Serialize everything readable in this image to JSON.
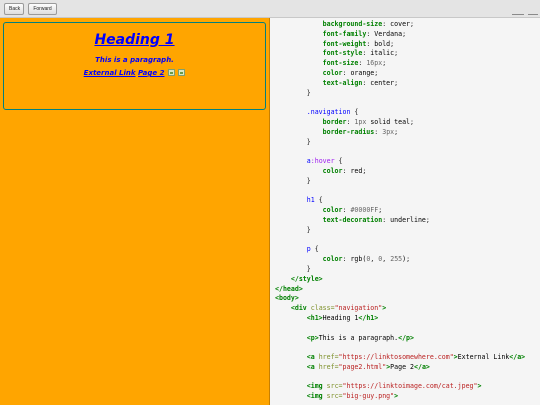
{
  "toolbar": {
    "back_label": "Back",
    "forward_label": "Forward"
  },
  "preview": {
    "heading": "Heading 1",
    "paragraph": "This is a paragraph.",
    "link1_label": "External Link",
    "link2_label": "Page 2",
    "colors": {
      "background": "#FFA500",
      "text": "#0000FF",
      "border": "#008080"
    }
  },
  "code": {
    "lines": [
      [
        [
          "    background-size",
          "prop"
        ],
        [
          ": ",
          "punct"
        ],
        [
          "cover",
          "val"
        ],
        [
          ";",
          "punct"
        ]
      ],
      [
        [
          "    font-family",
          "prop"
        ],
        [
          ": ",
          "punct"
        ],
        [
          "Verdana",
          "val"
        ],
        [
          ";",
          "punct"
        ]
      ],
      [
        [
          "    font-weight",
          "prop"
        ],
        [
          ": ",
          "punct"
        ],
        [
          "bold",
          "val"
        ],
        [
          ";",
          "punct"
        ]
      ],
      [
        [
          "    font-style",
          "prop"
        ],
        [
          ": ",
          "punct"
        ],
        [
          "italic",
          "val"
        ],
        [
          ";",
          "punct"
        ]
      ],
      [
        [
          "    font-size",
          "prop"
        ],
        [
          ": ",
          "punct"
        ],
        [
          "16px",
          "num"
        ],
        [
          ";",
          "punct"
        ]
      ],
      [
        [
          "    color",
          "prop"
        ],
        [
          ": ",
          "punct"
        ],
        [
          "orange",
          "val"
        ],
        [
          ";",
          "punct"
        ]
      ],
      [
        [
          "    text-align",
          "prop"
        ],
        [
          ": ",
          "punct"
        ],
        [
          "center",
          "val"
        ],
        [
          ";",
          "punct"
        ]
      ],
      [
        [
          "}",
          "punct"
        ]
      ],
      [
        [
          "",
          "punct"
        ]
      ],
      [
        [
          ".navigation",
          "sel"
        ],
        [
          " {",
          "punct"
        ]
      ],
      [
        [
          "    border",
          "prop"
        ],
        [
          ": ",
          "punct"
        ],
        [
          "1px",
          "num"
        ],
        [
          " solid teal",
          "val"
        ],
        [
          ";",
          "punct"
        ]
      ],
      [
        [
          "    border-radius",
          "prop"
        ],
        [
          ": ",
          "punct"
        ],
        [
          "3px",
          "num"
        ],
        [
          ";",
          "punct"
        ]
      ],
      [
        [
          "}",
          "punct"
        ]
      ],
      [
        [
          "",
          "punct"
        ]
      ],
      [
        [
          "a",
          "sel"
        ],
        [
          ":hover",
          "pseudo"
        ],
        [
          " {",
          "punct"
        ]
      ],
      [
        [
          "    color",
          "prop"
        ],
        [
          ": ",
          "punct"
        ],
        [
          "red",
          "val"
        ],
        [
          ";",
          "punct"
        ]
      ],
      [
        [
          "}",
          "punct"
        ]
      ],
      [
        [
          "",
          "punct"
        ]
      ],
      [
        [
          "h1",
          "sel"
        ],
        [
          " {",
          "punct"
        ]
      ],
      [
        [
          "    color",
          "prop"
        ],
        [
          ": ",
          "punct"
        ],
        [
          "#0000FF",
          "num"
        ],
        [
          ";",
          "punct"
        ]
      ],
      [
        [
          "    text-decoration",
          "prop"
        ],
        [
          ": ",
          "punct"
        ],
        [
          "underline",
          "val"
        ],
        [
          ";",
          "punct"
        ]
      ],
      [
        [
          "}",
          "punct"
        ]
      ],
      [
        [
          "",
          "punct"
        ]
      ],
      [
        [
          "p",
          "sel"
        ],
        [
          " {",
          "punct"
        ]
      ],
      [
        [
          "    color",
          "prop"
        ],
        [
          ": ",
          "punct"
        ],
        [
          "rgb(",
          "val"
        ],
        [
          "0",
          "num"
        ],
        [
          ", ",
          "punct"
        ],
        [
          "0",
          "num"
        ],
        [
          ", ",
          "punct"
        ],
        [
          "255",
          "num"
        ],
        [
          ")",
          "val"
        ],
        [
          ";",
          "punct"
        ]
      ],
      [
        [
          "}",
          "punct"
        ]
      ],
      [
        [
          "</style>",
          "tag"
        ]
      ],
      [
        [
          "</head>",
          "tag"
        ]
      ],
      [
        [
          "<body>",
          "tag"
        ]
      ],
      [
        [
          "<div",
          "tag"
        ],
        [
          " class=",
          "attr"
        ],
        [
          "\"navigation\"",
          "str"
        ],
        [
          ">",
          "tag"
        ]
      ],
      [
        [
          "    <h1>",
          "tag"
        ],
        [
          "Heading 1",
          "val"
        ],
        [
          "</h1>",
          "tag"
        ]
      ],
      [
        [
          "",
          "punct"
        ]
      ],
      [
        [
          "    <p>",
          "tag"
        ],
        [
          "This is a paragraph.",
          "val"
        ],
        [
          "</p>",
          "tag"
        ]
      ],
      [
        [
          "",
          "punct"
        ]
      ],
      [
        [
          "    <a",
          "tag"
        ],
        [
          " href=",
          "attr"
        ],
        [
          "\"https://linktosomewhere.com\"",
          "str"
        ],
        [
          ">",
          "tag"
        ],
        [
          "External Link",
          "val"
        ],
        [
          "</a>",
          "tag"
        ]
      ],
      [
        [
          "    <a",
          "tag"
        ],
        [
          " href=",
          "attr"
        ],
        [
          "\"page2.html\"",
          "str"
        ],
        [
          ">",
          "tag"
        ],
        [
          "Page 2",
          "val"
        ],
        [
          "</a>",
          "tag"
        ]
      ],
      [
        [
          "",
          "punct"
        ]
      ],
      [
        [
          "    <img",
          "tag"
        ],
        [
          " src=",
          "attr"
        ],
        [
          "\"https://linktoimage.com/cat.jpeg\"",
          "str"
        ],
        [
          ">",
          "tag"
        ]
      ],
      [
        [
          "    <img",
          "tag"
        ],
        [
          " src=",
          "attr"
        ],
        [
          "\"big-guy.png\"",
          "str"
        ],
        [
          ">",
          "tag"
        ]
      ]
    ]
  }
}
